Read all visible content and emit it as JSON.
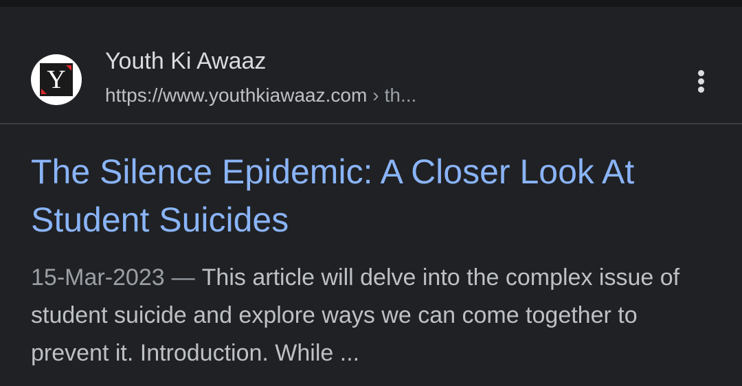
{
  "result": {
    "site_name": "Youth Ki Awaaz",
    "url_base": "https://www.youthkiawaaz.com",
    "url_separator": "›",
    "url_path": "th...",
    "favicon": {
      "icon": "youth-ki-awaaz-logo",
      "letter": "Y",
      "bg_color": "#ffffff",
      "accent_color": "#e02828"
    },
    "menu_icon": "more-vert-icon",
    "title": "The Silence Epidemic: A Closer Look At Student Suicides",
    "date": "15-Mar-2023",
    "dash": "—",
    "snippet": "This article will delve into the complex issue of student suicide and explore ways we can come together to prevent it. Introduction. While ..."
  },
  "colors": {
    "background": "#202124",
    "title_link": "#8ab4f8",
    "text_primary": "#dadce0",
    "text_secondary": "#bdc1c6",
    "text_muted": "#9aa0a6",
    "divider": "#3c4043"
  }
}
